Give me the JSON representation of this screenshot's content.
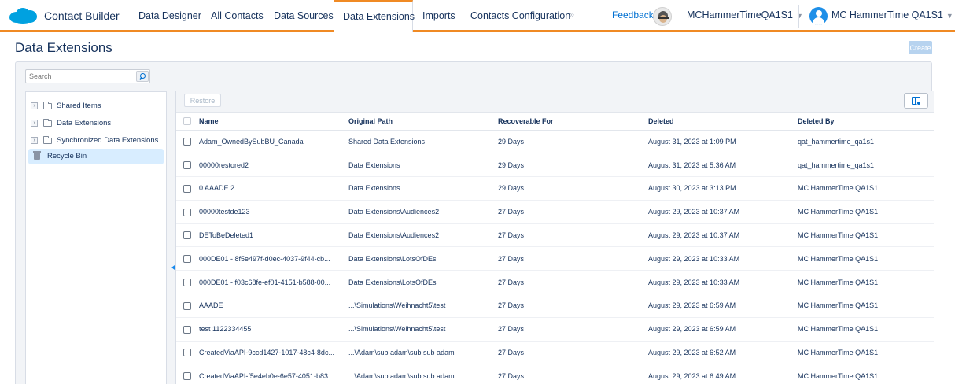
{
  "app": {
    "title": "Contact Builder",
    "brand_color": "#00a1e0",
    "accent_color": "#f08a24"
  },
  "nav": {
    "tabs": [
      {
        "label": "Data Designer"
      },
      {
        "label": "All Contacts"
      },
      {
        "label": "Data Sources"
      },
      {
        "label": "Data Extensions",
        "active": true
      },
      {
        "label": "Imports"
      },
      {
        "label": "Contacts Configuration"
      }
    ],
    "more": "»",
    "feedback": "Feedback",
    "business_unit": "MCHammerTimeQA1S1",
    "user_name": "MC HammerTime QA1S1",
    "caret": "▼"
  },
  "page": {
    "title": "Data Extensions",
    "create_label": "Create"
  },
  "search": {
    "placeholder": "Search",
    "value": ""
  },
  "sidebar": {
    "items": [
      {
        "label": "Shared Items",
        "expander": "›",
        "icon": "folder-icon"
      },
      {
        "label": "Data Extensions",
        "expander": "›",
        "icon": "folder-icon"
      },
      {
        "label": "Synchronized Data Extensions",
        "expander": "›",
        "icon": "folder-icon"
      },
      {
        "label": "Recycle Bin",
        "icon": "trash-icon",
        "selected": true
      }
    ]
  },
  "toolbar": {
    "restore_label": "Restore"
  },
  "table": {
    "columns": [
      "Name",
      "Original Path",
      "Recoverable For",
      "Deleted",
      "Deleted By"
    ],
    "rows": [
      [
        "Adam_OwnedBySubBU_Canada",
        "Shared Data Extensions",
        "29 Days",
        "August 31, 2023 at 1:09 PM",
        "qat_hammertime_qa1s1"
      ],
      [
        "00000restored2",
        "Data Extensions",
        "29 Days",
        "August 31, 2023 at 5:36 AM",
        "qat_hammertime_qa1s1"
      ],
      [
        "0 AAADE 2",
        "Data Extensions",
        "29 Days",
        "August 30, 2023 at 3:13 PM",
        "MC HammerTime QA1S1"
      ],
      [
        "00000testde123",
        "Data Extensions\\Audiences2",
        "27 Days",
        "August 29, 2023 at 10:37 AM",
        "MC HammerTime QA1S1"
      ],
      [
        "DEToBeDeleted1",
        "Data Extensions\\Audiences2",
        "27 Days",
        "August 29, 2023 at 10:37 AM",
        "MC HammerTime QA1S1"
      ],
      [
        "000DE01 - 8f5e497f-d0ec-4037-9f44-cb...",
        "Data Extensions\\LotsOfDEs",
        "27 Days",
        "August 29, 2023 at 10:33 AM",
        "MC HammerTime QA1S1"
      ],
      [
        "000DE01 - f03c68fe-ef01-4151-b588-00...",
        "Data Extensions\\LotsOfDEs",
        "27 Days",
        "August 29, 2023 at 10:33 AM",
        "MC HammerTime QA1S1"
      ],
      [
        "AAADE",
        "...\\Simulations\\Weihnacht5\\test",
        "27 Days",
        "August 29, 2023 at 6:59 AM",
        "MC HammerTime QA1S1"
      ],
      [
        "test 1122334455",
        "...\\Simulations\\Weihnacht5\\test",
        "27 Days",
        "August 29, 2023 at 6:59 AM",
        "MC HammerTime QA1S1"
      ],
      [
        "CreatedViaAPI-9ccd1427-1017-48c4-8dc...",
        "...\\Adam\\sub adam\\sub sub adam",
        "27 Days",
        "August 29, 2023 at 6:52 AM",
        "MC HammerTime QA1S1"
      ],
      [
        "CreatedViaAPI-f5e4eb0e-6e57-4051-b83...",
        "...\\Adam\\sub adam\\sub sub adam",
        "27 Days",
        "August 29, 2023 at 6:49 AM",
        "MC HammerTime QA1S1"
      ]
    ]
  }
}
